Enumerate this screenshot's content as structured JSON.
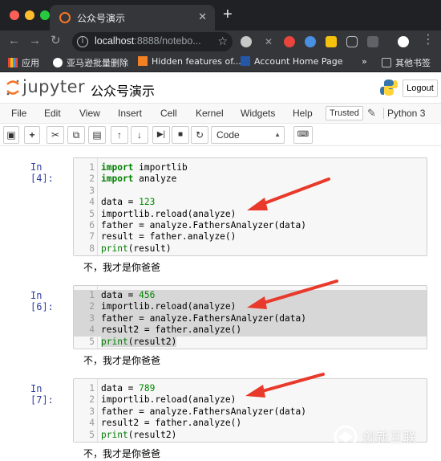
{
  "browser": {
    "tab_title": "公众号演示",
    "tab_close": "✕",
    "new_tab": "+",
    "url_host": "localhost",
    "url_rest": ":8888/notebo...",
    "bookmarks": [
      {
        "label": "应用"
      },
      {
        "label": "亚马逊批量删除"
      },
      {
        "label": "Hidden features of..."
      },
      {
        "label": "Account Home Page"
      },
      {
        "label": "其他书签"
      }
    ],
    "more": "»"
  },
  "jupyter": {
    "logo_text": "jupyter",
    "notebook_name": "公众号演示",
    "logout_label": "Logout",
    "menu": [
      "File",
      "Edit",
      "View",
      "Insert",
      "Cell",
      "Kernel",
      "Widgets",
      "Help"
    ],
    "trusted_label": "Trusted",
    "kernel_label": "Python 3",
    "cell_type": "Code",
    "accent_color": "#f37726"
  },
  "cells": [
    {
      "prompt": "In [4]:",
      "output": "不，我才是你爸爸",
      "lines": [
        "import importlib",
        "import analyze",
        "",
        "data = 123",
        "importlib.reload(analyze)",
        "father = analyze.FathersAnalyzer(data)",
        "result = father.analyze()",
        "print(result)"
      ]
    },
    {
      "prompt": "In [6]:",
      "output": "不，我才是你爸爸",
      "lines": [
        "data = 456",
        "importlib.reload(analyze)",
        "father = analyze.FathersAnalyzer(data)",
        "result2 = father.analyze()",
        "print(result2)"
      ]
    },
    {
      "prompt": "In [7]:",
      "output": "不，我才是你爸爸",
      "lines": [
        "data = 789",
        "importlib.reload(analyze)",
        "father = analyze.FathersAnalyzer(data)",
        "result2 = father.analyze()",
        "print(result2)"
      ]
    }
  ],
  "watermark": "创新互联"
}
